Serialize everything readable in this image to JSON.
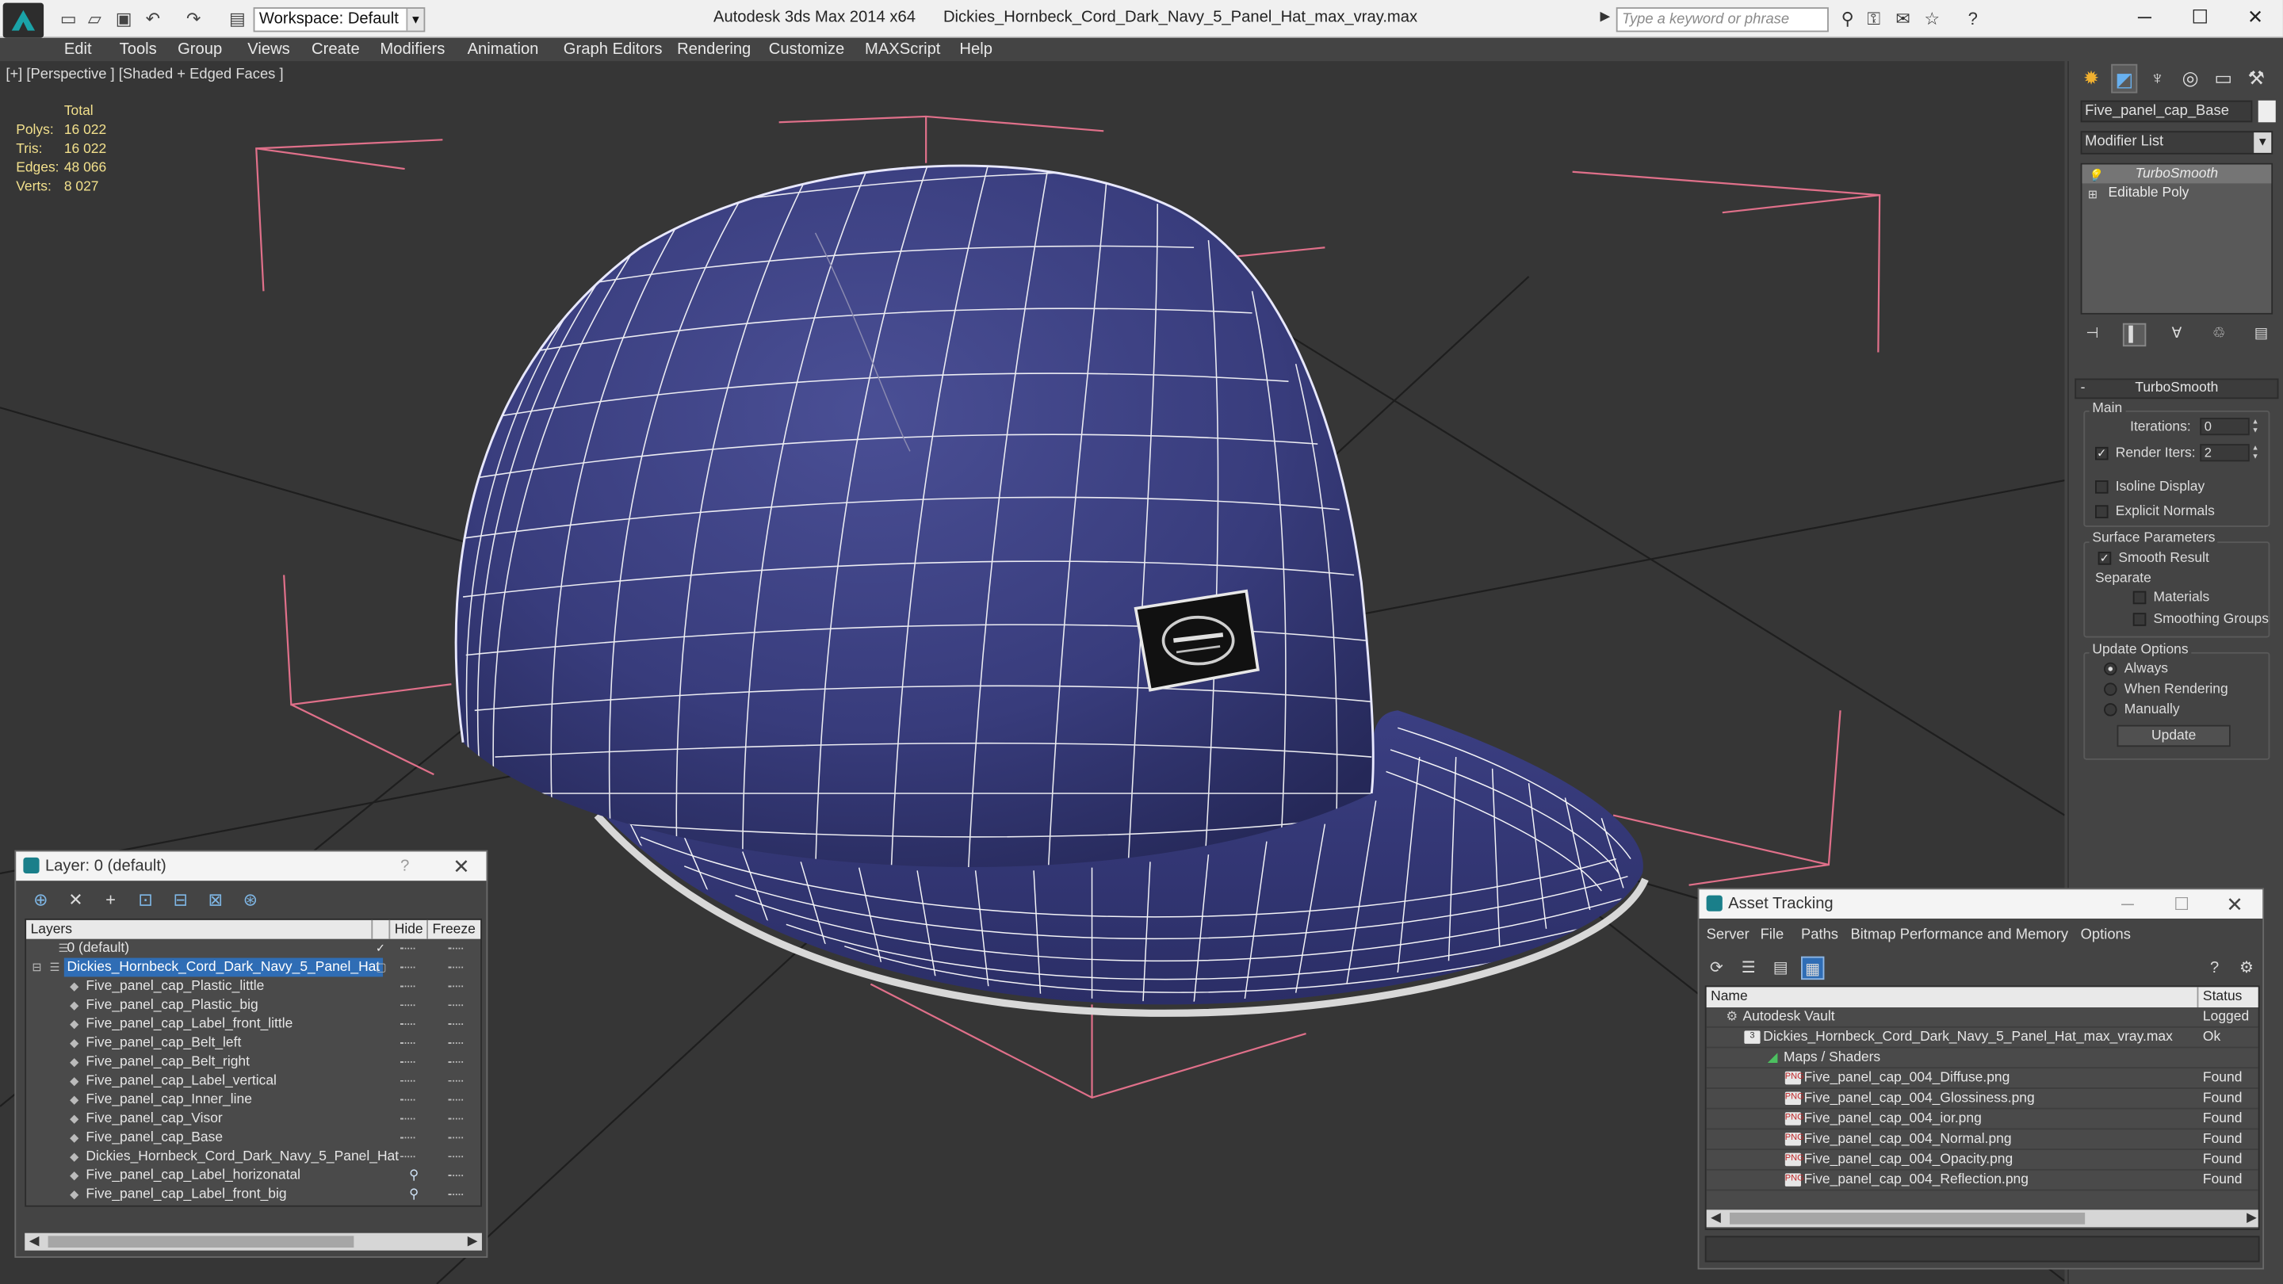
{
  "titlebar": {
    "workspace_value": "Workspace: Default",
    "app_title": "Autodesk 3ds Max 2014 x64",
    "file_title": "Dickies_Hornbeck_Cord_Dark_Navy_5_Panel_Hat_max_vray.max",
    "search_placeholder": "Type a keyword or phrase",
    "win_minimize": "─",
    "win_maximize": "☐",
    "win_close": "✕"
  },
  "menu": [
    "Edit",
    "Tools",
    "Group",
    "Views",
    "Create",
    "Modifiers",
    "Animation",
    "Graph Editors",
    "Rendering",
    "Customize",
    "MAXScript",
    "Help"
  ],
  "viewport": {
    "label": "[+] [Perspective ] [Shaded + Edged Faces ]",
    "stats_header": "Total",
    "stats": [
      {
        "k": "Polys:",
        "v": "16 022"
      },
      {
        "k": "Tris:",
        "v": "16 022"
      },
      {
        "k": "Edges:",
        "v": "48 066"
      },
      {
        "k": "Verts:",
        "v": "8 027"
      }
    ],
    "cap_color": "#383c7c",
    "wire_color": "#ffffff",
    "bbox_color": "#e0708a"
  },
  "command_panel": {
    "object_name": "Five_panel_cap_Base",
    "modifier_list": "Modifier List",
    "stack": [
      "TurboSmooth",
      "Editable Poly"
    ],
    "rollout_title": "TurboSmooth",
    "main_group": "Main",
    "iterations_label": "Iterations:",
    "iterations_value": "0",
    "render_iters_label": "Render Iters:",
    "render_iters_value": "2",
    "isoline_label": "Isoline Display",
    "explicit_normals_label": "Explicit Normals",
    "surface_group": "Surface Parameters",
    "smooth_result_label": "Smooth Result",
    "separate_label": "Separate",
    "materials_label": "Materials",
    "smoothing_groups_label": "Smoothing Groups",
    "update_group": "Update Options",
    "always_label": "Always",
    "when_rendering_label": "When Rendering",
    "manually_label": "Manually",
    "update_button": "Update"
  },
  "layer_dialog": {
    "title": "Layer: 0 (default)",
    "help": "?",
    "close": "✕",
    "col_layers": "Layers",
    "col_hide": "Hide",
    "col_freeze": "Freeze",
    "rows": [
      {
        "name": "0 (default)"
      },
      {
        "name": "Dickies_Hornbeck_Cord_Dark_Navy_5_Panel_Hat"
      },
      {
        "name": "Five_panel_cap_Plastic_little"
      },
      {
        "name": "Five_panel_cap_Plastic_big"
      },
      {
        "name": "Five_panel_cap_Label_front_little"
      },
      {
        "name": "Five_panel_cap_Belt_left"
      },
      {
        "name": "Five_panel_cap_Belt_right"
      },
      {
        "name": "Five_panel_cap_Label_vertical"
      },
      {
        "name": "Five_panel_cap_Inner_line"
      },
      {
        "name": "Five_panel_cap_Visor"
      },
      {
        "name": "Five_panel_cap_Base"
      },
      {
        "name": "Dickies_Hornbeck_Cord_Dark_Navy_5_Panel_Hat"
      },
      {
        "name": "Five_panel_cap_Label_horizonatal"
      },
      {
        "name": "Five_panel_cap_Label_front_big"
      }
    ]
  },
  "asset_dialog": {
    "title": "Asset Tracking",
    "menu": [
      "Server",
      "File",
      "Paths",
      "Bitmap Performance and Memory",
      "Options"
    ],
    "col_name": "Name",
    "col_status": "Status",
    "rows": [
      {
        "name": "Autodesk Vault",
        "status": "Logged"
      },
      {
        "name": "Dickies_Hornbeck_Cord_Dark_Navy_5_Panel_Hat_max_vray.max",
        "status": "Ok"
      },
      {
        "name": "Maps / Shaders",
        "status": ""
      },
      {
        "name": "Five_panel_cap_004_Diffuse.png",
        "status": "Found"
      },
      {
        "name": "Five_panel_cap_004_Glossiness.png",
        "status": "Found"
      },
      {
        "name": "Five_panel_cap_004_ior.png",
        "status": "Found"
      },
      {
        "name": "Five_panel_cap_004_Normal.png",
        "status": "Found"
      },
      {
        "name": "Five_panel_cap_004_Opacity.png",
        "status": "Found"
      },
      {
        "name": "Five_panel_cap_004_Reflection.png",
        "status": "Found"
      }
    ]
  }
}
